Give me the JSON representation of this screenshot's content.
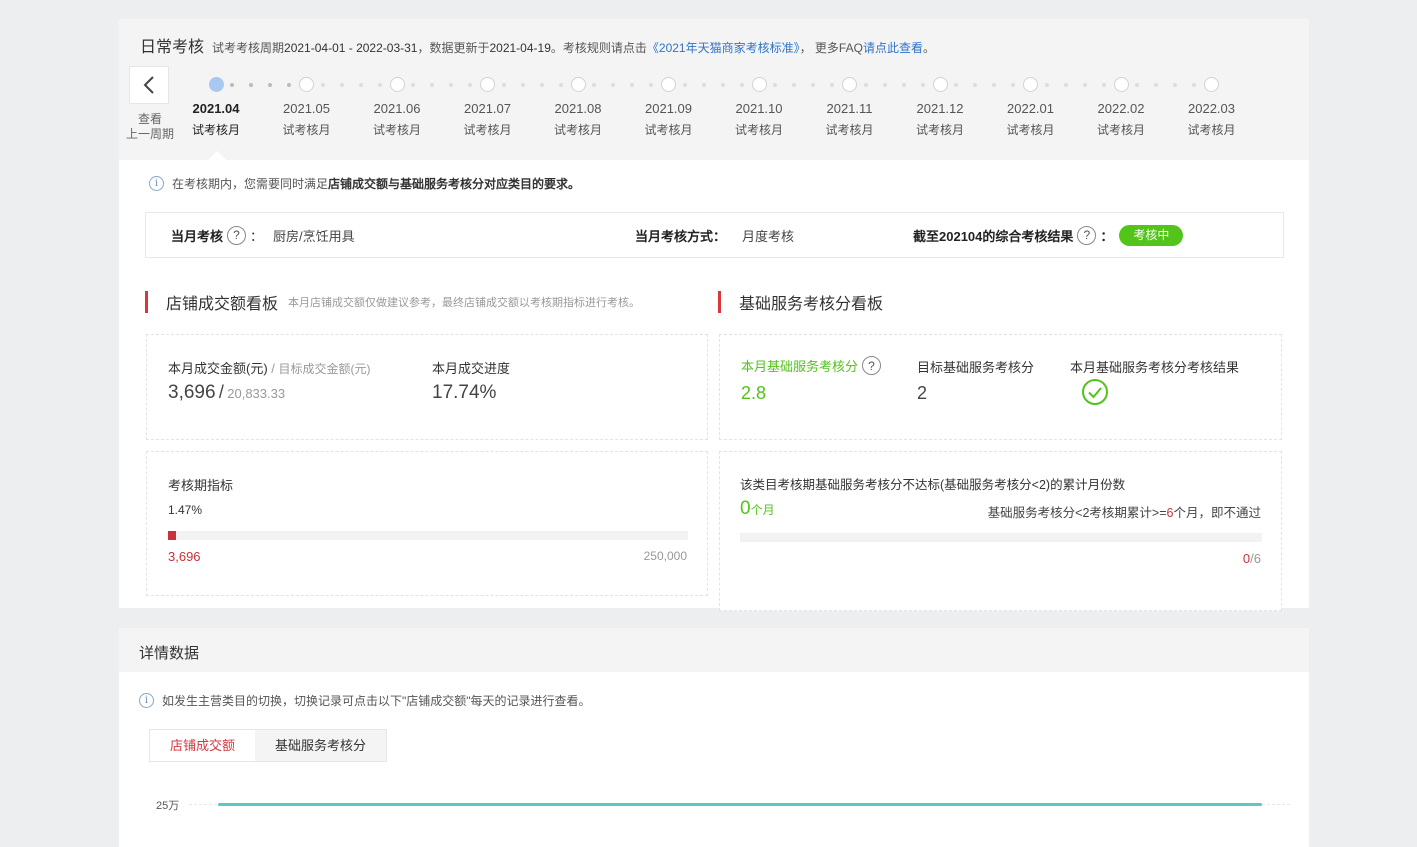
{
  "daily": {
    "title": "日常考核",
    "subtitle_prefix": "试考考核周期",
    "period": "2021-04-01 - 2022-03-31",
    "update_prefix": "，数据更新于",
    "update_date": "2021-04-19",
    "rule_prefix": "。考核规则请点击",
    "rule_link": "《2021年天猫商家考核标准》",
    "faq_prefix": "，  更多FAQ",
    "faq_link": "请点此查看",
    "faq_suffix": "。",
    "prev_label_line1": "查看",
    "prev_label_line2": "上一周期",
    "timeline": [
      {
        "date": "2021.04",
        "label": "试考核月",
        "active": true
      },
      {
        "date": "2021.05",
        "label": "试考核月"
      },
      {
        "date": "2021.06",
        "label": "试考核月"
      },
      {
        "date": "2021.07",
        "label": "试考核月"
      },
      {
        "date": "2021.08",
        "label": "试考核月"
      },
      {
        "date": "2021.09",
        "label": "试考核月"
      },
      {
        "date": "2021.10",
        "label": "试考核月"
      },
      {
        "date": "2021.11",
        "label": "试考核月"
      },
      {
        "date": "2021.12",
        "label": "试考核月"
      },
      {
        "date": "2022.01",
        "label": "试考核月"
      },
      {
        "date": "2022.02",
        "label": "试考核月"
      },
      {
        "date": "2022.03",
        "label": "试考核月"
      }
    ],
    "notice_prefix": "在考核期内，您需要同时满足",
    "notice_bold": "店铺成交额与基础服务考核分对应类目的要求。",
    "exam": {
      "month_label": "当月考核",
      "colon": "：",
      "category": "厨房/烹饪用具",
      "method_label": "当月考核方式：",
      "method_value": "月度考核",
      "result_label": "截至202104的综合考核结果",
      "status": "考核中"
    }
  },
  "sales": {
    "title": "店铺成交额看板",
    "note": "本月店铺成交额仅做建议参考，最终店铺成交额以考核期指标进行考核。",
    "amount_label": "本月成交金额(元)",
    "sep": "/",
    "target_label": "目标成交金额(元)",
    "amount": "3,696",
    "target": "20,833.33",
    "progress_label": "本月成交进度",
    "progress": "17.74%",
    "period_label": "考核期指标",
    "period_pct": "1.47%",
    "period_fraction": 0.0147,
    "period_current": "3,696",
    "period_target": "250,000"
  },
  "service": {
    "title": "基础服务考核分看板",
    "score_label": "本月基础服务考核分",
    "score": "2.8",
    "target_label": "目标基础服务考核分",
    "target": "2",
    "result_label": "本月基础服务考核分考核结果",
    "fail_label": "该类目考核期基础服务考核分不达标(基础服务考核分<2)的累计月份数",
    "months": "0",
    "months_unit": "个月",
    "rule_prefix": "基础服务考核分<2考核期累计>=",
    "rule_num": "6",
    "rule_suffix": "个月，即不通过",
    "count": "0",
    "count_total": "/6",
    "count_fraction": 0
  },
  "details": {
    "title": "详情数据",
    "notice": "如发生主营类目的切换，切换记录可点击以下\"店铺成交额\"每天的记录进行查看。",
    "tabs": [
      "店铺成交额",
      "基础服务考核分"
    ],
    "chart_ytick": "25万"
  },
  "colors": {
    "accent_red": "#d9363e",
    "success_green": "#52c41a",
    "link_blue": "#2f74c8",
    "chart_teal": "#5bc7c6"
  }
}
